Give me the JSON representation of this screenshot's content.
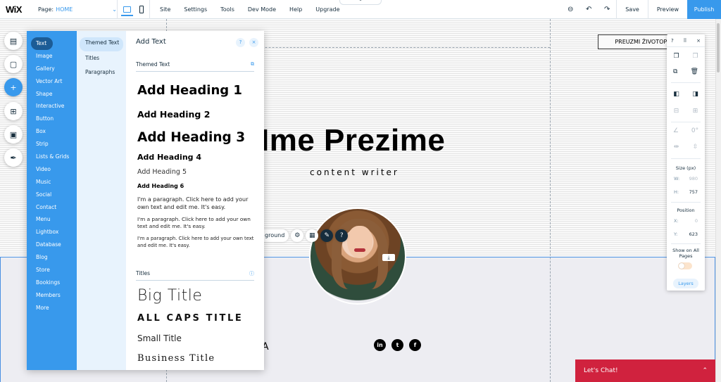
{
  "topbar": {
    "logo": "WiX",
    "page_label": "Page:",
    "page_value": "HOME",
    "menu": [
      "Site",
      "Settings",
      "Tools",
      "Dev Mode",
      "Help",
      "Upgrade"
    ],
    "save": "Save",
    "preview": "Preview",
    "publish": "Publish"
  },
  "site": {
    "name": "Ime Prezime",
    "role": "content writer",
    "cv_button": "PREUZMI ŽIVOTOPIS",
    "toolbar_pill": "ground",
    "partial_letter": "A"
  },
  "chat": {
    "label": "Let's Chat!"
  },
  "add_panel": {
    "categories": [
      "Text",
      "Image",
      "Gallery",
      "Vector Art",
      "Shape",
      "Interactive",
      "Button",
      "Box",
      "Strip",
      "Lists & Grids",
      "Video",
      "Music",
      "Social",
      "Contact",
      "Menu",
      "Lightbox",
      "Database",
      "Blog",
      "Store",
      "Bookings",
      "Members",
      "More"
    ],
    "subcategories": [
      "Themed Text",
      "Titles",
      "Paragraphs"
    ],
    "title": "Add Text",
    "themed_section": "Themed Text",
    "headings": [
      "Add Heading 1",
      "Add Heading 2",
      "Add Heading 3",
      "Add Heading 4",
      "Add Heading 5",
      "Add Heading 6"
    ],
    "paragraphs": [
      "I'm a paragraph. Click here to add your own text and edit me. It's easy.",
      "I'm a paragraph. Click here to add your own text and edit me. It's easy.",
      "I'm a paragraph. Click here to add your own text and edit me. It's easy."
    ],
    "titles_section": "Titles",
    "titles": [
      "Big Title",
      "ALL CAPS TITLE",
      "Small Title",
      "Business Title"
    ]
  },
  "right_panel": {
    "help": "?",
    "close": "×",
    "rotation": "0°",
    "size_label": "Size (px)",
    "w_label": "W:",
    "w_value": "980",
    "h_label": "H:",
    "h_value": "757",
    "position_label": "Position",
    "x_label": "X:",
    "x_value": "0",
    "y_label": "Y:",
    "y_value": "623",
    "show_all_pages": "Show on All Pages",
    "layers": "Layers"
  }
}
